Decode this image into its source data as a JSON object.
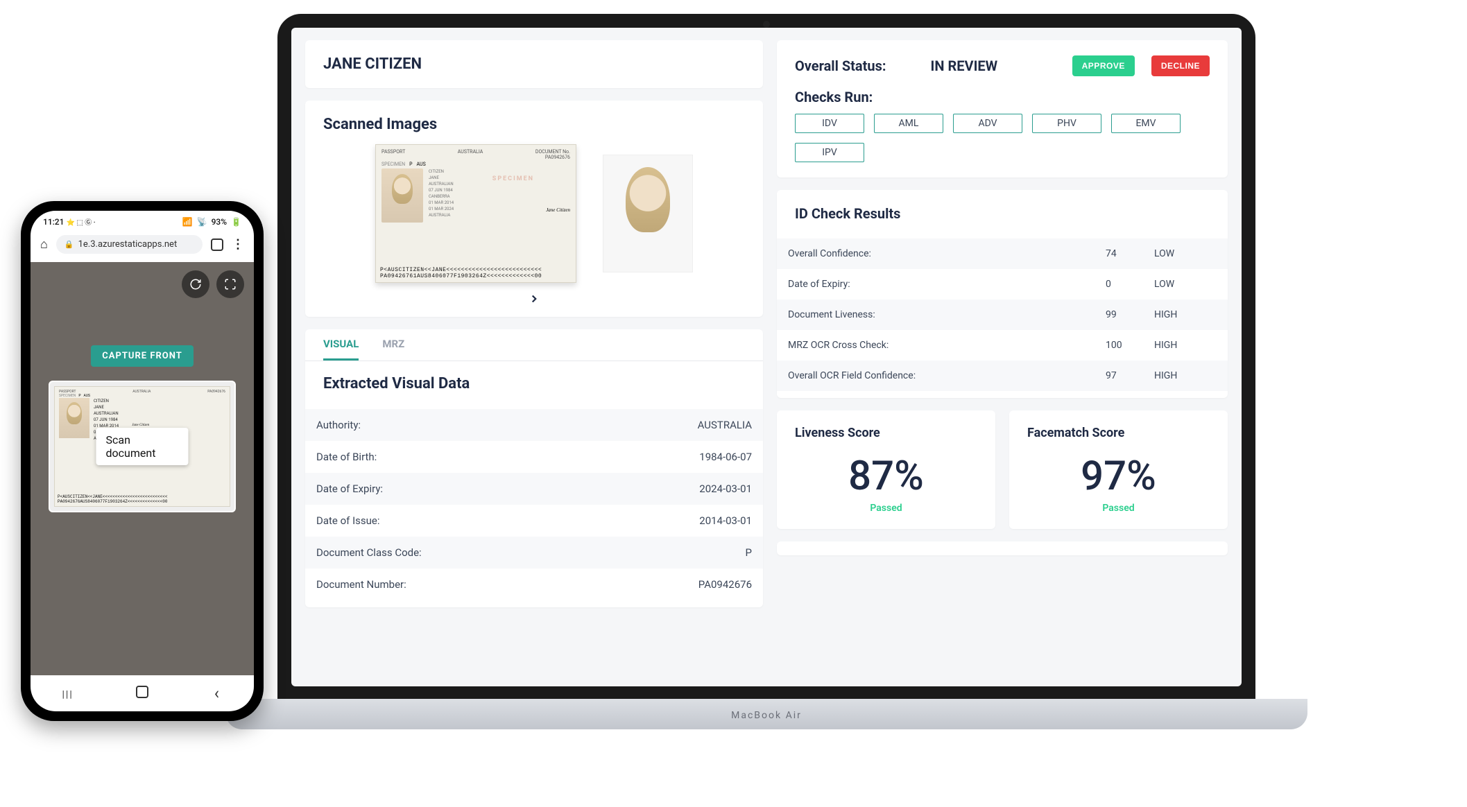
{
  "phone": {
    "statusbar": {
      "time": "11:21",
      "left_icons": "⭐ ⬚ Ⓖ ·",
      "signal": "📶",
      "battery": "93%"
    },
    "urlbar": {
      "url": "1e.3.azurestaticapps.net"
    },
    "camera": {
      "capture_label": "CAPTURE FRONT",
      "scan_overlay": "Scan document"
    },
    "passport": {
      "top_left": "PASSPORT",
      "top_mid": "AUSTRALIA",
      "top_right": "PA0942676",
      "specimen": "SPECIMEN",
      "code": "P",
      "country": "AUS",
      "surname": "CITIZEN",
      "given": "JANE",
      "nationality": "AUSTRALIAN",
      "dob": "07 JUN 1984",
      "signature": "Jane Citizen",
      "issue": "01 MAR 2014",
      "expiry": "01 MAR 2024",
      "authority": "AUSTRALIA",
      "mrz1": "P<AUSCITIZEN<<JANE<<<<<<<<<<<<<<<<<<<<<<<<<<",
      "mrz2": "PA0942676AUS8406077F1903264Z<<<<<<<<<<<<<<00"
    }
  },
  "review": {
    "name": "JANE CITIZEN",
    "scanned_title": "Scanned Images",
    "tabs": {
      "visual": "VISUAL",
      "mrz": "MRZ"
    },
    "extracted_title": "Extracted Visual Data",
    "extracted": [
      {
        "k": "Authority:",
        "v": "AUSTRALIA"
      },
      {
        "k": "Date of Birth:",
        "v": "1984-06-07"
      },
      {
        "k": "Date of Expiry:",
        "v": "2024-03-01"
      },
      {
        "k": "Date of Issue:",
        "v": "2014-03-01"
      },
      {
        "k": "Document Class Code:",
        "v": "P"
      },
      {
        "k": "Document Number:",
        "v": "PA0942676"
      }
    ],
    "passport": {
      "top_left": "PASSPORT",
      "top_mid": "AUSTRALIA",
      "top_right_label": "DOCUMENT No.",
      "top_right": "PA0942676",
      "specimen": "SPECIMEN",
      "code": "P",
      "country": "AUS",
      "surname": "CITIZEN",
      "given": "JANE",
      "nationality": "AUSTRALIAN",
      "dob": "07 JUN 1984",
      "pob": "CANBERRA",
      "signature": "Jane Citizen",
      "issue": "01 MAR 2014",
      "expiry": "01 MAR 2024",
      "authority": "AUSTRALIA",
      "mrz1": "P<AUSCITIZEN<<JANE<<<<<<<<<<<<<<<<<<<<<<<<<<",
      "mrz2": "PA09426761AUS8406077F1903264Z<<<<<<<<<<<<<00"
    }
  },
  "status": {
    "label": "Overall Status:",
    "value": "IN REVIEW",
    "approve": "APPROVE",
    "decline": "DECLINE",
    "checks_label": "Checks Run:",
    "checks": [
      "IDV",
      "AML",
      "ADV",
      "PHV",
      "EMV",
      "IPV"
    ]
  },
  "idcheck": {
    "title": "ID Check Results",
    "rows": [
      {
        "metric": "Overall Confidence:",
        "num": "74",
        "level": "LOW"
      },
      {
        "metric": "Date of Expiry:",
        "num": "0",
        "level": "LOW"
      },
      {
        "metric": "Document Liveness:",
        "num": "99",
        "level": "HIGH"
      },
      {
        "metric": "MRZ OCR Cross Check:",
        "num": "100",
        "level": "HIGH"
      },
      {
        "metric": "Overall OCR Field Confidence:",
        "num": "97",
        "level": "HIGH"
      }
    ]
  },
  "scores": {
    "liveness": {
      "title": "Liveness Score",
      "value": "87%",
      "status": "Passed"
    },
    "facematch": {
      "title": "Facematch Score",
      "value": "97%",
      "status": "Passed"
    }
  },
  "laptop_label": "MacBook Air"
}
